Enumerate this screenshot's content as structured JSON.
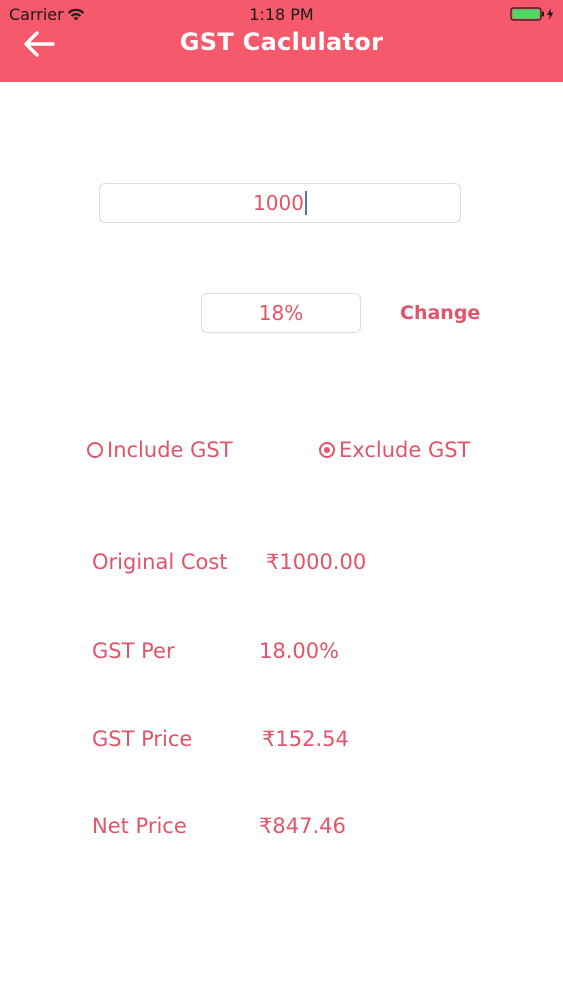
{
  "status_bar": {
    "carrier": "Carrier",
    "time": "1:18 PM"
  },
  "header": {
    "title": "GST Caclulator",
    "color": "#f5596b"
  },
  "form": {
    "amount_value": "1000",
    "rate_value": "18%",
    "change_label": "Change",
    "include_label": "Include GST",
    "exclude_label": "Exclude GST",
    "selected_option": "Exclude GST"
  },
  "results": {
    "original_cost_label": "Original Cost",
    "original_cost_value": "₹1000.00",
    "gst_per_label": "GST Per",
    "gst_per_value": "18.00%",
    "gst_price_label": "GST Price",
    "gst_price_value": "₹152.54",
    "net_price_label": "Net Price",
    "net_price_value": "₹847.46"
  },
  "colors": {
    "accent": "#e0556a",
    "header": "#f5596b",
    "battery": "#4cd964"
  }
}
